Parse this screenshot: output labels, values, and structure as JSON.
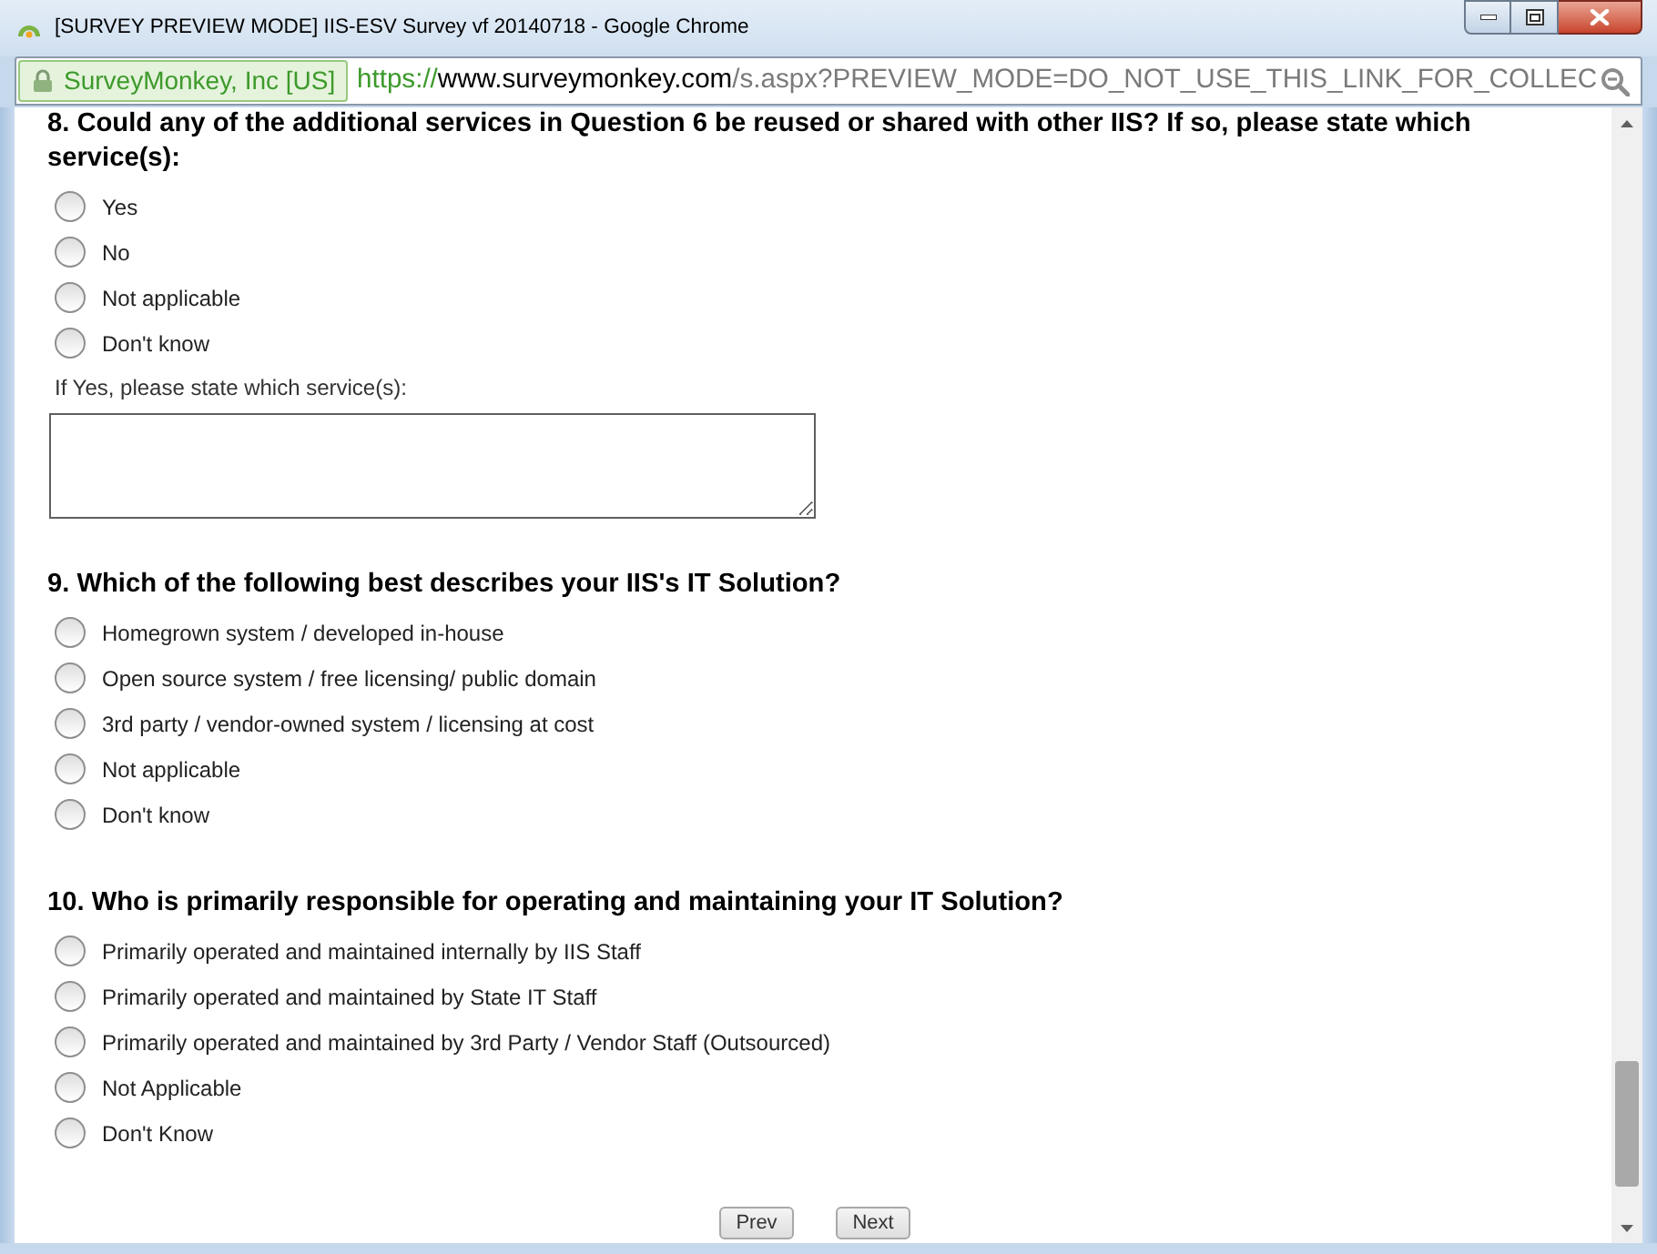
{
  "window": {
    "title": "[SURVEY PREVIEW MODE] IIS-ESV Survey vf 20140718 - Google Chrome"
  },
  "address_bar": {
    "site_identity": "SurveyMonkey, Inc [US]",
    "url": {
      "scheme": "https://",
      "host": "www.surveymonkey.com",
      "path": "/s.aspx?PREVIEW_MODE=DO_NOT_USE_THIS_LINK_FOR_COLLEC"
    }
  },
  "questions": [
    {
      "title": "8. Could any of the additional services in Question 6 be reused or shared with other IIS? If so, please state which service(s):",
      "options": [
        {
          "label": "Yes",
          "selected": false
        },
        {
          "label": "No",
          "selected": false
        },
        {
          "label": "Not applicable",
          "selected": false
        },
        {
          "label": "Don't know",
          "selected": false
        }
      ],
      "comment": {
        "label": "If Yes, please state which service(s):"
      }
    },
    {
      "title": "9. Which of the following best describes your IIS's IT Solution?",
      "options": [
        {
          "label": "Homegrown system / developed in-house",
          "selected": false
        },
        {
          "label": "Open source system / free licensing/ public domain",
          "selected": false
        },
        {
          "label": "3rd party / vendor-owned system / licensing at cost",
          "selected": false
        },
        {
          "label": "Not applicable",
          "selected": false
        },
        {
          "label": "Don't know",
          "selected": false
        }
      ]
    },
    {
      "title": "10. Who is primarily responsible for operating and maintaining your IT Solution?",
      "options": [
        {
          "label": "Primarily operated and maintained internally by IIS Staff",
          "selected": false
        },
        {
          "label": "Primarily operated and maintained by State IT Staff",
          "selected": false
        },
        {
          "label": "Primarily operated and maintained by 3rd Party / Vendor Staff (Outsourced)",
          "selected": false
        },
        {
          "label": "Not Applicable",
          "selected": false
        },
        {
          "label": "Don't Know",
          "selected": false
        }
      ]
    }
  ],
  "buttons": [
    {
      "label": "Prev"
    },
    {
      "label": "Next"
    }
  ]
}
